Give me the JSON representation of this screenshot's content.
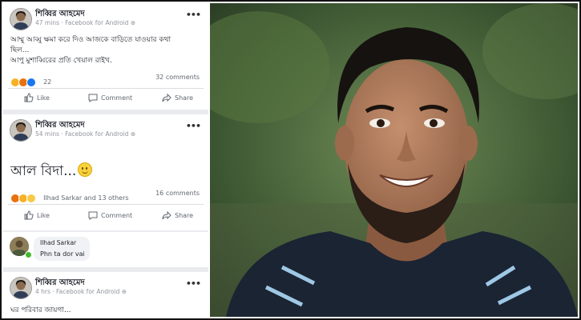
{
  "posts": [
    {
      "author": "শিব্বির আহমেদ",
      "time": "47 mins · Facebook for Android",
      "lines": [
        "আম্মু আব্বু ক্ষমা করে দিও আজকে বাড়িতে যাওয়ার কথা",
        "ছিল...",
        "আপু মুশাব্বিরের প্রতি খেয়াল রাইখ."
      ],
      "reaction_count": "22",
      "comments": "32 comments"
    },
    {
      "author": "শিব্বির আহমেদ",
      "time": "54 mins · Facebook for Android",
      "big_text": "আল বিদা...",
      "reaction_names": "Ilhad Sarkar and 13 others",
      "comments": "16 comments"
    },
    {
      "author": "শিব্বির আহমেদ",
      "time": "4 hrs · Facebook for Android",
      "lines": [
        "ঘর পরিবার জায়গা..."
      ]
    }
  ],
  "actions": {
    "like": "Like",
    "comment": "Comment",
    "share": "Share"
  },
  "comment": {
    "name": "Ilhad Sarkar",
    "text": "Phn ta dor vai"
  },
  "icons": [
    "user-avatar",
    "more-dots-icon",
    "globe-icon",
    "like-icon",
    "comment-icon",
    "share-icon",
    "smiley-emoji",
    "haha-reaction",
    "angry-reaction",
    "sad-reaction"
  ],
  "colors": {
    "feed_bg": "#e9ebee",
    "meta": "#90949c",
    "online": "#42b72a"
  }
}
